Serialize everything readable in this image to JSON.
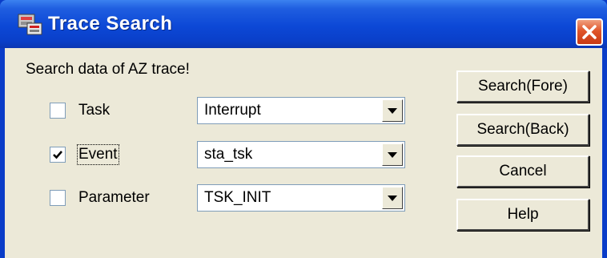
{
  "window": {
    "title": "Trace Search"
  },
  "caption": "Search data of AZ trace!",
  "rows": [
    {
      "label": "Task",
      "checked": false,
      "combo_value": "Interrupt"
    },
    {
      "label": "Event",
      "checked": true,
      "combo_value": "sta_tsk"
    },
    {
      "label": "Parameter",
      "checked": false,
      "combo_value": "TSK_INIT"
    }
  ],
  "buttons": {
    "search_fore": "Search(Fore)",
    "search_back": "Search(Back)",
    "cancel": "Cancel",
    "help": "Help"
  },
  "icons": {
    "app": "trace-app-icon",
    "close": "close-icon",
    "combo_arrow": "chevron-down-icon",
    "check": "check-icon"
  },
  "colors": {
    "titlebar": "#0a3fc9",
    "close": "#e0552a",
    "dialog_face": "#ece9d8"
  }
}
